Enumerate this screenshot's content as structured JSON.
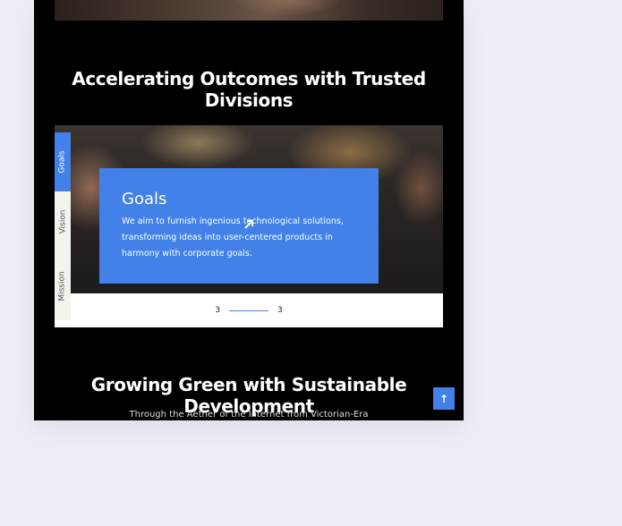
{
  "sections": {
    "divisions_heading": "Accelerating Outcomes with Trusted Divisions",
    "sustainable_heading": "Growing Green with Sustainable Development",
    "footer_text": "Through the Aether of the Internet from Victorian-Era"
  },
  "tabs": {
    "items": [
      "Goals",
      "Vision",
      "Mission"
    ],
    "active": "Goals"
  },
  "card": {
    "title": "Goals",
    "text": "We aim to furnish ingenious technological solutions, transforming ideas into user-centered products in harmony with corporate goals.",
    "icon": "arrow-up-right-icon"
  },
  "pager": {
    "current": "3",
    "total": "3"
  },
  "scroll_top": {
    "icon": "arrow-up-icon",
    "label": "↑"
  },
  "colors": {
    "accent": "#4281e8",
    "background": "#000000",
    "page": "#eceef5"
  }
}
